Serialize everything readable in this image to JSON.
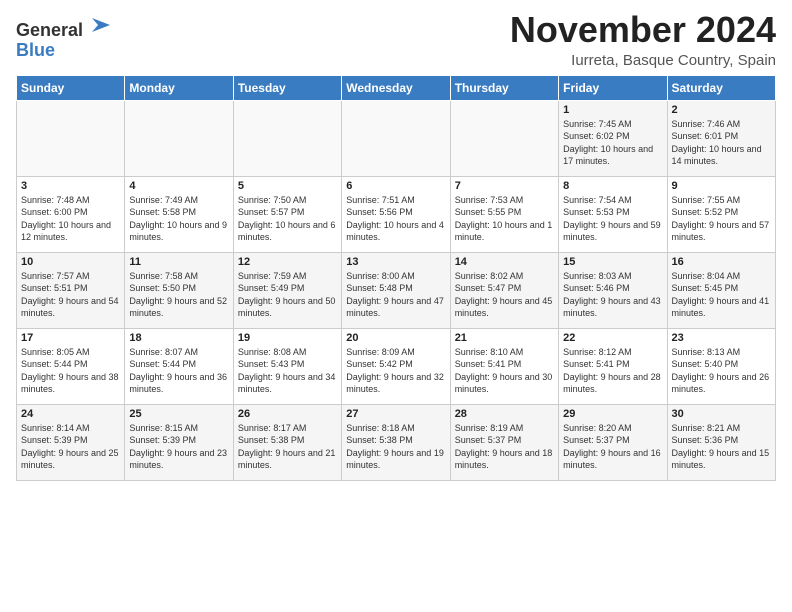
{
  "header": {
    "logo_general": "General",
    "logo_blue": "Blue",
    "month_title": "November 2024",
    "location": "Iurreta, Basque Country, Spain"
  },
  "days_of_week": [
    "Sunday",
    "Monday",
    "Tuesday",
    "Wednesday",
    "Thursday",
    "Friday",
    "Saturday"
  ],
  "weeks": [
    [
      {
        "day": "",
        "info": ""
      },
      {
        "day": "",
        "info": ""
      },
      {
        "day": "",
        "info": ""
      },
      {
        "day": "",
        "info": ""
      },
      {
        "day": "",
        "info": ""
      },
      {
        "day": "1",
        "info": "Sunrise: 7:45 AM\nSunset: 6:02 PM\nDaylight: 10 hours and 17 minutes."
      },
      {
        "day": "2",
        "info": "Sunrise: 7:46 AM\nSunset: 6:01 PM\nDaylight: 10 hours and 14 minutes."
      }
    ],
    [
      {
        "day": "3",
        "info": "Sunrise: 7:48 AM\nSunset: 6:00 PM\nDaylight: 10 hours and 12 minutes."
      },
      {
        "day": "4",
        "info": "Sunrise: 7:49 AM\nSunset: 5:58 PM\nDaylight: 10 hours and 9 minutes."
      },
      {
        "day": "5",
        "info": "Sunrise: 7:50 AM\nSunset: 5:57 PM\nDaylight: 10 hours and 6 minutes."
      },
      {
        "day": "6",
        "info": "Sunrise: 7:51 AM\nSunset: 5:56 PM\nDaylight: 10 hours and 4 minutes."
      },
      {
        "day": "7",
        "info": "Sunrise: 7:53 AM\nSunset: 5:55 PM\nDaylight: 10 hours and 1 minute."
      },
      {
        "day": "8",
        "info": "Sunrise: 7:54 AM\nSunset: 5:53 PM\nDaylight: 9 hours and 59 minutes."
      },
      {
        "day": "9",
        "info": "Sunrise: 7:55 AM\nSunset: 5:52 PM\nDaylight: 9 hours and 57 minutes."
      }
    ],
    [
      {
        "day": "10",
        "info": "Sunrise: 7:57 AM\nSunset: 5:51 PM\nDaylight: 9 hours and 54 minutes."
      },
      {
        "day": "11",
        "info": "Sunrise: 7:58 AM\nSunset: 5:50 PM\nDaylight: 9 hours and 52 minutes."
      },
      {
        "day": "12",
        "info": "Sunrise: 7:59 AM\nSunset: 5:49 PM\nDaylight: 9 hours and 50 minutes."
      },
      {
        "day": "13",
        "info": "Sunrise: 8:00 AM\nSunset: 5:48 PM\nDaylight: 9 hours and 47 minutes."
      },
      {
        "day": "14",
        "info": "Sunrise: 8:02 AM\nSunset: 5:47 PM\nDaylight: 9 hours and 45 minutes."
      },
      {
        "day": "15",
        "info": "Sunrise: 8:03 AM\nSunset: 5:46 PM\nDaylight: 9 hours and 43 minutes."
      },
      {
        "day": "16",
        "info": "Sunrise: 8:04 AM\nSunset: 5:45 PM\nDaylight: 9 hours and 41 minutes."
      }
    ],
    [
      {
        "day": "17",
        "info": "Sunrise: 8:05 AM\nSunset: 5:44 PM\nDaylight: 9 hours and 38 minutes."
      },
      {
        "day": "18",
        "info": "Sunrise: 8:07 AM\nSunset: 5:44 PM\nDaylight: 9 hours and 36 minutes."
      },
      {
        "day": "19",
        "info": "Sunrise: 8:08 AM\nSunset: 5:43 PM\nDaylight: 9 hours and 34 minutes."
      },
      {
        "day": "20",
        "info": "Sunrise: 8:09 AM\nSunset: 5:42 PM\nDaylight: 9 hours and 32 minutes."
      },
      {
        "day": "21",
        "info": "Sunrise: 8:10 AM\nSunset: 5:41 PM\nDaylight: 9 hours and 30 minutes."
      },
      {
        "day": "22",
        "info": "Sunrise: 8:12 AM\nSunset: 5:41 PM\nDaylight: 9 hours and 28 minutes."
      },
      {
        "day": "23",
        "info": "Sunrise: 8:13 AM\nSunset: 5:40 PM\nDaylight: 9 hours and 26 minutes."
      }
    ],
    [
      {
        "day": "24",
        "info": "Sunrise: 8:14 AM\nSunset: 5:39 PM\nDaylight: 9 hours and 25 minutes."
      },
      {
        "day": "25",
        "info": "Sunrise: 8:15 AM\nSunset: 5:39 PM\nDaylight: 9 hours and 23 minutes."
      },
      {
        "day": "26",
        "info": "Sunrise: 8:17 AM\nSunset: 5:38 PM\nDaylight: 9 hours and 21 minutes."
      },
      {
        "day": "27",
        "info": "Sunrise: 8:18 AM\nSunset: 5:38 PM\nDaylight: 9 hours and 19 minutes."
      },
      {
        "day": "28",
        "info": "Sunrise: 8:19 AM\nSunset: 5:37 PM\nDaylight: 9 hours and 18 minutes."
      },
      {
        "day": "29",
        "info": "Sunrise: 8:20 AM\nSunset: 5:37 PM\nDaylight: 9 hours and 16 minutes."
      },
      {
        "day": "30",
        "info": "Sunrise: 8:21 AM\nSunset: 5:36 PM\nDaylight: 9 hours and 15 minutes."
      }
    ]
  ]
}
